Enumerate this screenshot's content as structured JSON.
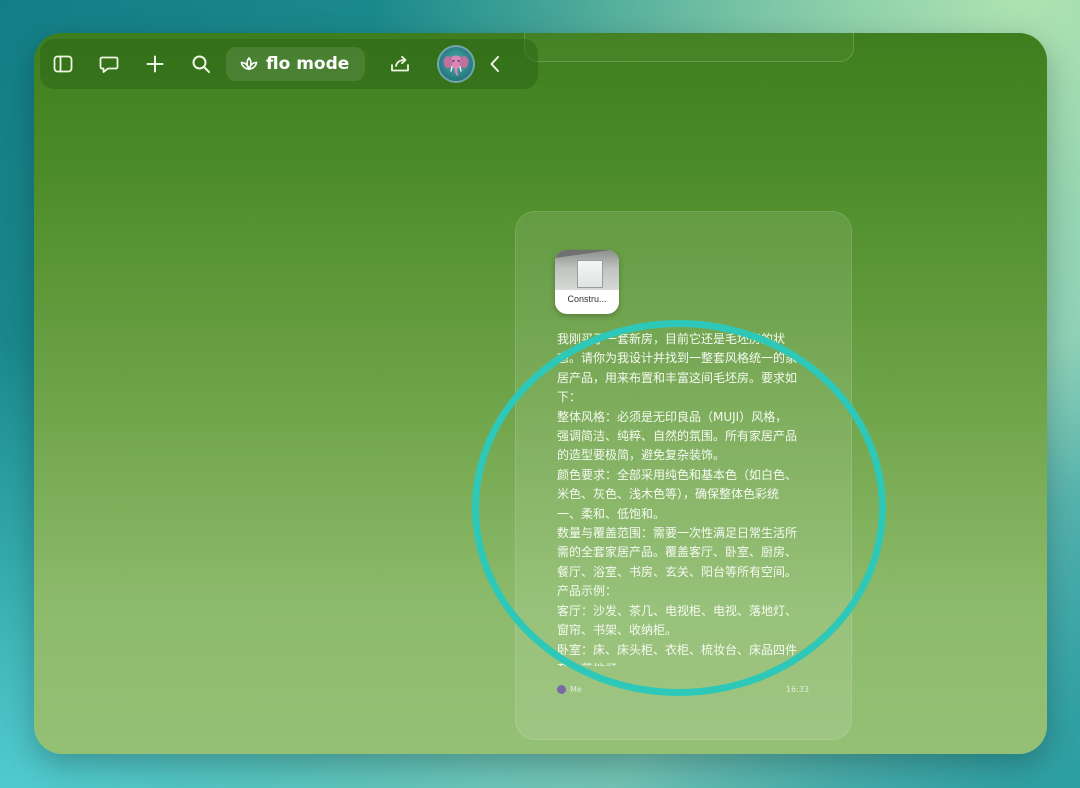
{
  "toolbar": {
    "icons": [
      "sidebar-toggle-icon",
      "chat-bubble-icon",
      "plus-icon",
      "search-icon",
      "lotus-icon",
      "share-icon",
      "chevron-left-icon"
    ],
    "mode_label": "flo mode"
  },
  "message": {
    "attachment": {
      "name": "Constru..."
    },
    "text": "我刚买了一套新房，目前它还是毛坯房的状态。请你为我设计并找到一整套风格统一的家居产品，用来布置和丰富这间毛坯房。要求如下：\n整体风格：必须是无印良品（MUJI）风格，强调简洁、纯粹、自然的氛围。所有家居产品的造型要极简，避免复杂装饰。\n颜色要求：全部采用纯色和基本色（如白色、米色、灰色、浅木色等），确保整体色彩统一、柔和、低饱和。\n数量与覆盖范围：需要一次性满足日常生活所需的全套家居产品。覆盖客厅、卧室、厨房、餐厅、浴室、书房、玄关、阳台等所有空间。产品示例：\n客厅：沙发、茶几、电视柜、电视、落地灯、窗帘、书架、收纳柜。\n卧室：床、床头柜、衣柜、梳妆台、床品四件套、落地灯",
    "sender": "Me",
    "time": "16:33"
  },
  "colors": {
    "window_top": "#3e7e1e",
    "window_bottom": "#94c075",
    "highlight_ring": "#2ec8b8"
  }
}
